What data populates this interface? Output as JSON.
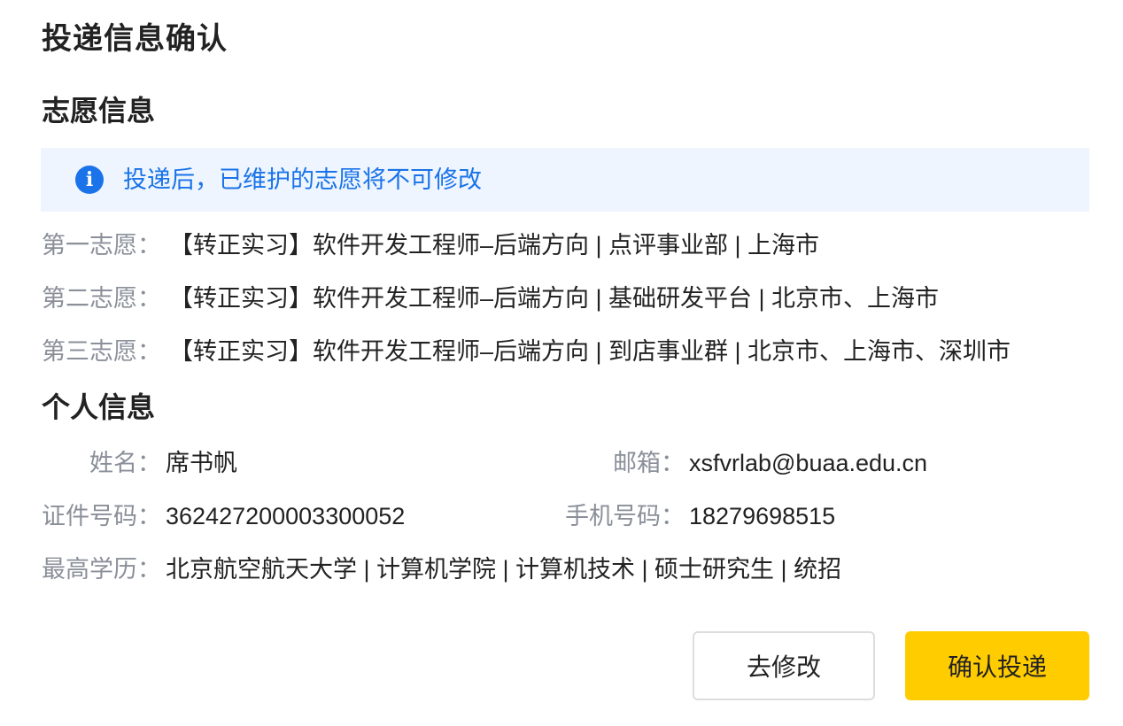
{
  "dialog": {
    "title": "投递信息确认"
  },
  "preferences": {
    "section_title": "志愿信息",
    "notice": {
      "icon": "info-icon",
      "icon_glyph": "i",
      "text": "投递后，已维护的志愿将不可修改",
      "color": "#1a73e8",
      "background": "#eef5ff"
    },
    "items": [
      {
        "label": "第一志愿：",
        "value": "【转正实习】软件开发工程师–后端方向 | 点评事业部 | 上海市"
      },
      {
        "label": "第二志愿：",
        "value": "【转正实习】软件开发工程师–后端方向 | 基础研发平台 | 北京市、上海市"
      },
      {
        "label": "第三志愿：",
        "value": "【转正实习】软件开发工程师–后端方向 | 到店事业群 | 北京市、上海市、深圳市"
      }
    ]
  },
  "personal": {
    "section_title": "个人信息",
    "name": {
      "label": "姓名：",
      "value": "席书帆"
    },
    "email": {
      "label": "邮箱：",
      "value": "xsfvrlab@buaa.edu.cn"
    },
    "id_number": {
      "label": "证件号码：",
      "value": "362427200003300052"
    },
    "phone": {
      "label": "手机号码：",
      "value": "18279698515"
    },
    "education": {
      "label": "最高学历：",
      "value": "北京航空航天大学 | 计算机学院 | 计算机技术 | 硕士研究生 | 统招"
    }
  },
  "actions": {
    "modify_label": "去修改",
    "confirm_label": "确认投递",
    "confirm_color": "#ffcc00"
  }
}
